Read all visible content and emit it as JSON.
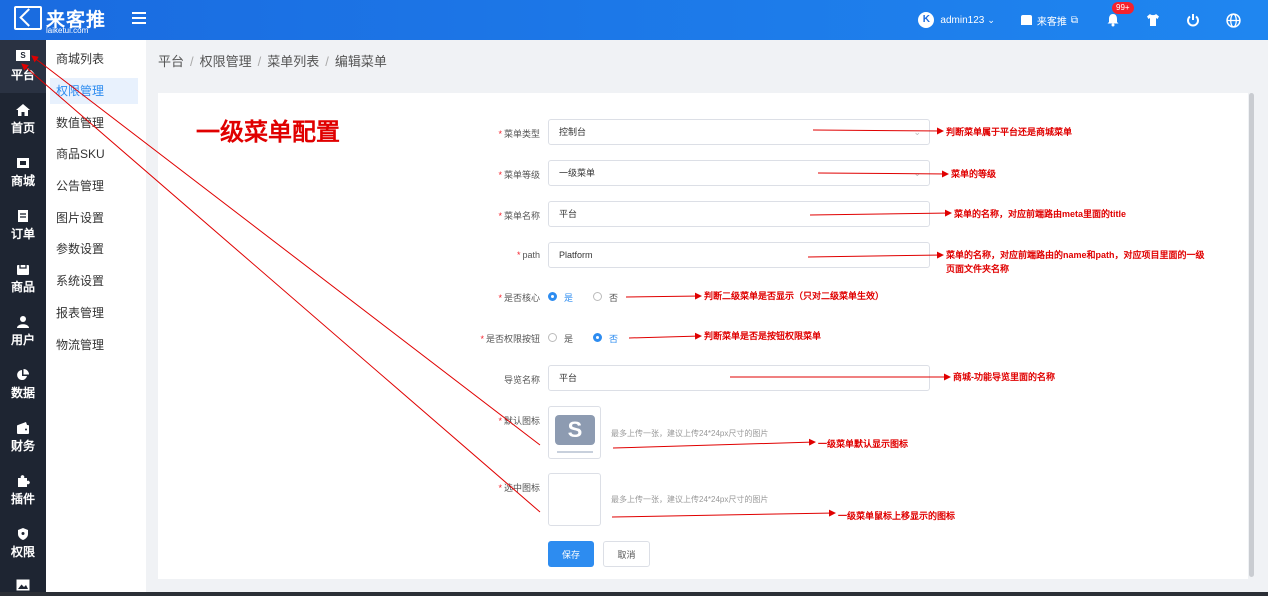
{
  "app": {
    "logo_name": "来客推",
    "logo_sub": "laiketui.com",
    "user": "admin123",
    "shop": "来客推",
    "notifications_badge": "99+"
  },
  "sidebar": {
    "items": [
      {
        "label": "平台",
        "icon": "platform-s-icon"
      },
      {
        "label": "首页",
        "icon": "home-icon"
      },
      {
        "label": "商城",
        "icon": "shop-icon"
      },
      {
        "label": "订单",
        "icon": "order-icon"
      },
      {
        "label": "商品",
        "icon": "goods-icon"
      },
      {
        "label": "用户",
        "icon": "user-icon"
      },
      {
        "label": "数据",
        "icon": "pie-chart-icon"
      },
      {
        "label": "财务",
        "icon": "wallet-icon"
      },
      {
        "label": "插件",
        "icon": "puzzle-icon"
      },
      {
        "label": "权限",
        "icon": "shield-icon"
      },
      {
        "label": "",
        "icon": "image-icon"
      }
    ]
  },
  "submenu": {
    "items": [
      "商城列表",
      "权限管理",
      "数值管理",
      "商品SKU",
      "公告管理",
      "图片设置",
      "参数设置",
      "系统设置",
      "报表管理",
      "物流管理"
    ],
    "active_index": 1
  },
  "breadcrumb": [
    "平台",
    "权限管理",
    "菜单列表",
    "编辑菜单"
  ],
  "title": "一级菜单配置",
  "form": {
    "menu_type": {
      "label": "菜单类型",
      "value": "控制台"
    },
    "menu_level": {
      "label": "菜单等级",
      "value": "一级菜单"
    },
    "menu_name": {
      "label": "菜单名称",
      "value": "平台"
    },
    "path": {
      "label": "path",
      "value": "Platform"
    },
    "is_core": {
      "label": "是否核心",
      "yes": "是",
      "no": "否",
      "selected": "是"
    },
    "is_permission_button": {
      "label": "是否权限按钮",
      "yes": "是",
      "no": "否",
      "selected": "否"
    },
    "nav_name": {
      "label": "导览名称",
      "value": "平台"
    },
    "default_icon": {
      "label": "默认图标",
      "hint": "最多上传一张，建议上传24*24px尺寸的图片"
    },
    "selected_icon": {
      "label": "选中图标",
      "hint": "最多上传一张，建议上传24*24px尺寸的图片"
    },
    "save": "保存",
    "cancel": "取消"
  },
  "annotations": {
    "menu_type": "判断菜单属于平台还是商城菜单",
    "menu_level": "菜单的等级",
    "menu_name": "菜单的名称，对应前端路由meta里面的title",
    "path_line1": "菜单的名称，对应前端路由的name和path，对应项目里面的一级",
    "path_line2": "页面文件夹名称",
    "is_core": "判断二级菜单是否显示（只对二级菜单生效）",
    "is_permission_button": "判断菜单是否是按钮权限菜单",
    "nav_name": "商城-功能导览里面的名称",
    "default_icon": "一级菜单默认显示图标",
    "selected_icon": "一级菜单鼠标上移显示的图标"
  },
  "colors": {
    "primary": "#2d8cf0",
    "annotation": "#e00000",
    "sidebar": "#1e2532",
    "topbar": "#1f86f0"
  }
}
